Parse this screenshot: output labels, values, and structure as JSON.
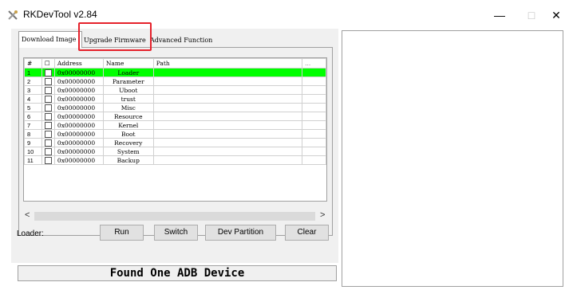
{
  "window": {
    "title": "RKDevTool v2.84",
    "minimize": "—",
    "maximize": "□",
    "close": "✕"
  },
  "tabs": [
    {
      "label": "Download Image"
    },
    {
      "label": "Upgrade Firmware"
    },
    {
      "label": "Advanced Function"
    }
  ],
  "table": {
    "headers": {
      "num": "#",
      "check": "☐",
      "address": "Address",
      "name": "Name",
      "path": "Path",
      "more": "..."
    },
    "rows": [
      {
        "num": "1",
        "address": "0x00000000",
        "name": "Loader"
      },
      {
        "num": "2",
        "address": "0x00000000",
        "name": "Parameter"
      },
      {
        "num": "3",
        "address": "0x00000000",
        "name": "Uboot"
      },
      {
        "num": "4",
        "address": "0x00000000",
        "name": "trust"
      },
      {
        "num": "5",
        "address": "0x00000000",
        "name": "Misc"
      },
      {
        "num": "6",
        "address": "0x00000000",
        "name": "Resource"
      },
      {
        "num": "7",
        "address": "0x00000000",
        "name": "Kernel"
      },
      {
        "num": "8",
        "address": "0x00000000",
        "name": "Boot"
      },
      {
        "num": "9",
        "address": "0x00000000",
        "name": "Recovery"
      },
      {
        "num": "10",
        "address": "0x00000000",
        "name": "System"
      },
      {
        "num": "11",
        "address": "0x00000000",
        "name": "Backup"
      }
    ]
  },
  "scroll": {
    "left": "<",
    "right": ">"
  },
  "bottom": {
    "loader_label": "Loader:",
    "run": "Run",
    "switch": "Switch",
    "dev_partition": "Dev Partition",
    "clear": "Clear"
  },
  "status": "Found One ADB Device",
  "colors": {
    "selected_row": "#00ff00",
    "highlight": "#e5212b"
  }
}
